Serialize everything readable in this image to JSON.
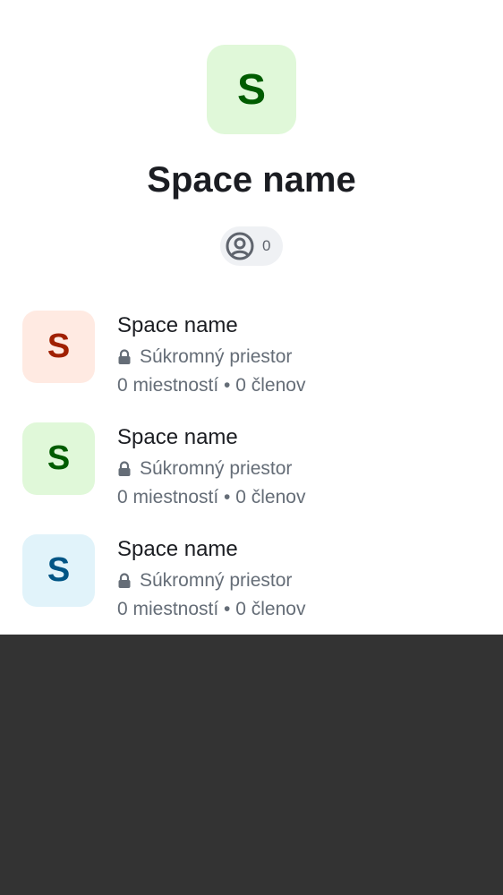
{
  "header": {
    "avatar_letter": "S",
    "avatar_bg": "#e0f8d9",
    "avatar_fg": "#005c00",
    "title": "Space name",
    "member_count": "0",
    "member_icon": "user-circle-icon"
  },
  "children": [
    {
      "avatar_letter": "S",
      "avatar_bg": "#ffeae2",
      "avatar_fg": "#a02000",
      "name": "Space name",
      "privacy": "Súkromný priestor",
      "privacy_icon": "lock-icon",
      "stats": "0 miestností • 0 členov"
    },
    {
      "avatar_letter": "S",
      "avatar_bg": "#e0f8d9",
      "avatar_fg": "#005c00",
      "name": "Space name",
      "privacy": "Súkromný priestor",
      "privacy_icon": "lock-icon",
      "stats": "0 miestností • 0 členov"
    },
    {
      "avatar_letter": "S",
      "avatar_bg": "#e1f3fa",
      "avatar_fg": "#005585",
      "name": "Space name",
      "privacy": "Súkromný priestor",
      "privacy_icon": "lock-icon",
      "stats": "0 miestností • 0 členov"
    }
  ],
  "colors": {
    "text_primary": "#1b1d22",
    "text_secondary": "#656d77",
    "pill_bg": "#eff1f4",
    "bottom_area": "#333333"
  }
}
